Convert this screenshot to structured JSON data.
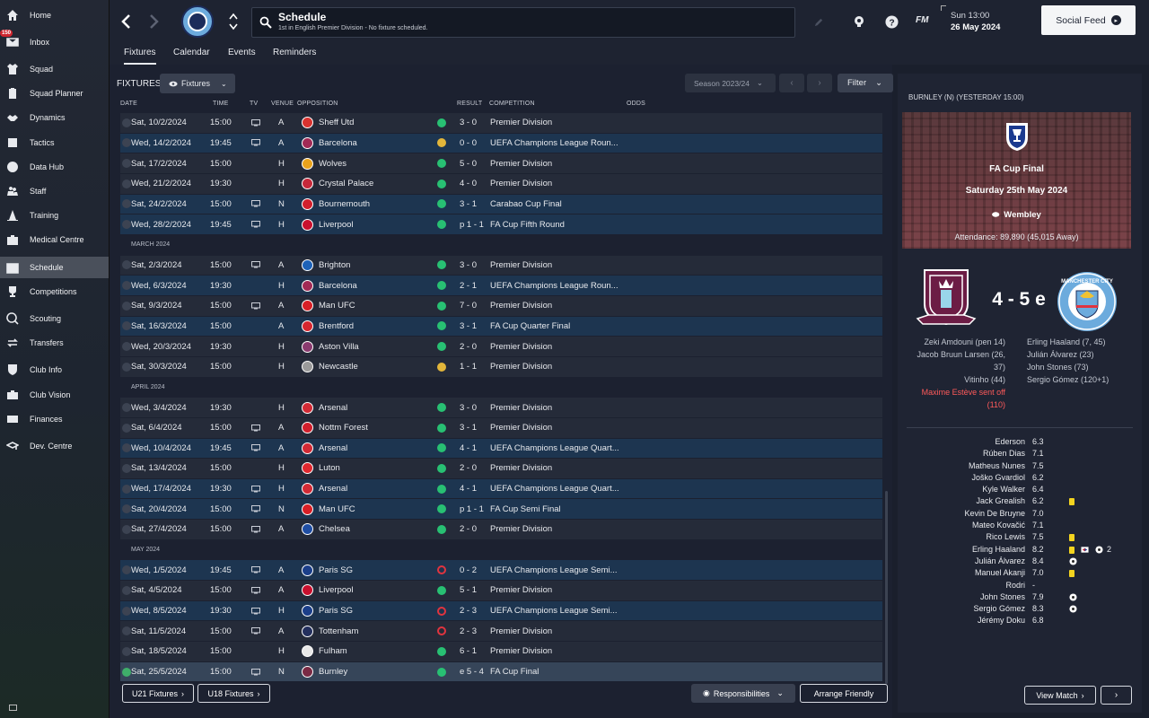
{
  "sidebar": {
    "items": [
      {
        "label": "Home",
        "icon": "home-icon"
      },
      {
        "label": "Inbox",
        "icon": "inbox-icon",
        "badge": "150"
      },
      {
        "label": "Squad",
        "icon": "shirt-icon"
      },
      {
        "label": "Squad Planner",
        "icon": "clipboard-icon"
      },
      {
        "label": "Dynamics",
        "icon": "handshake-icon"
      },
      {
        "label": "Tactics",
        "icon": "tactics-board-icon"
      },
      {
        "label": "Data Hub",
        "icon": "data-icon"
      },
      {
        "label": "Staff",
        "icon": "staff-icon"
      },
      {
        "label": "Training",
        "icon": "cone-icon"
      },
      {
        "label": "Medical Centre",
        "icon": "medical-icon"
      },
      {
        "label": "Schedule",
        "icon": "calendar-icon",
        "active": true
      },
      {
        "label": "Competitions",
        "icon": "trophy-icon"
      },
      {
        "label": "Scouting",
        "icon": "magnifier-icon"
      },
      {
        "label": "Transfers",
        "icon": "transfer-icon"
      },
      {
        "label": "Club Info",
        "icon": "shield-icon"
      },
      {
        "label": "Club Vision",
        "icon": "briefcase-icon"
      },
      {
        "label": "Finances",
        "icon": "money-icon"
      },
      {
        "label": "Dev. Centre",
        "icon": "graduation-icon"
      }
    ]
  },
  "header": {
    "title": "Schedule",
    "subtitle": "1st in English Premier Division - No fixture scheduled.",
    "brand": "FM",
    "day_time": "Sun 13:00",
    "date": "26 May 2024",
    "social_feed": "Social Feed"
  },
  "tabs": [
    "Fixtures",
    "Calendar",
    "Events",
    "Reminders"
  ],
  "toolbar": {
    "title": "FIXTURES",
    "view": "Fixtures",
    "season": "Season 2023/24",
    "filter": "Filter"
  },
  "columns": [
    "DATE",
    "TIME",
    "TV",
    "VENUE",
    "OPPOSITION",
    "RESULT",
    "COMPETITION",
    "ODDS"
  ],
  "fixtures": [
    {
      "type": "match",
      "date": "Sat, 10/2/2024",
      "time": "15:00",
      "tv": true,
      "venue": "A",
      "opp": "Sheff Utd",
      "outcome": "win",
      "result": "3 - 0",
      "comp": "Premier Division",
      "shade": "dark",
      "logo": "#d8322f"
    },
    {
      "type": "match",
      "date": "Wed, 14/2/2024",
      "time": "19:45",
      "tv": true,
      "venue": "A",
      "opp": "Barcelona",
      "outcome": "draw",
      "result": "0 - 0",
      "comp": "UEFA Champions League Roun...",
      "shade": "blue",
      "logo": "#a22a55"
    },
    {
      "type": "match",
      "date": "Sat, 17/2/2024",
      "time": "15:00",
      "tv": false,
      "venue": "H",
      "opp": "Wolves",
      "outcome": "win",
      "result": "5 - 0",
      "comp": "Premier Division",
      "shade": "dark",
      "logo": "#e9a21c"
    },
    {
      "type": "match",
      "date": "Wed, 21/2/2024",
      "time": "19:30",
      "tv": false,
      "venue": "H",
      "opp": "Crystal Palace",
      "outcome": "win",
      "result": "4 - 0",
      "comp": "Premier Division",
      "shade": "dark",
      "logo": "#c7293a"
    },
    {
      "type": "match",
      "date": "Sat, 24/2/2024",
      "time": "15:00",
      "tv": true,
      "venue": "N",
      "opp": "Bournemouth",
      "outcome": "win",
      "result": "3 - 1",
      "comp": "Carabao Cup Final",
      "shade": "blue",
      "logo": "#d11f2c"
    },
    {
      "type": "match",
      "date": "Wed, 28/2/2024",
      "time": "19:45",
      "tv": true,
      "venue": "H",
      "opp": "Liverpool",
      "outcome": "win",
      "result": "p 1 - 1",
      "comp": "FA Cup Fifth Round",
      "shade": "blue",
      "logo": "#c8102e"
    },
    {
      "type": "month",
      "label": "MARCH 2024"
    },
    {
      "type": "match",
      "date": "Sat, 2/3/2024",
      "time": "15:00",
      "tv": true,
      "venue": "A",
      "opp": "Brighton",
      "outcome": "win",
      "result": "3 - 0",
      "comp": "Premier Division",
      "shade": "dark",
      "logo": "#1d62b8"
    },
    {
      "type": "match",
      "date": "Wed, 6/3/2024",
      "time": "19:30",
      "tv": false,
      "venue": "H",
      "opp": "Barcelona",
      "outcome": "win",
      "result": "2 - 1",
      "comp": "UEFA Champions League Roun...",
      "shade": "blue",
      "logo": "#a22a55"
    },
    {
      "type": "match",
      "date": "Sat, 9/3/2024",
      "time": "15:00",
      "tv": true,
      "venue": "A",
      "opp": "Man UFC",
      "outcome": "win",
      "result": "7 - 0",
      "comp": "Premier Division",
      "shade": "dark",
      "logo": "#d81f26"
    },
    {
      "type": "match",
      "date": "Sat, 16/3/2024",
      "time": "15:00",
      "tv": false,
      "venue": "A",
      "opp": "Brentford",
      "outcome": "win",
      "result": "3 - 1",
      "comp": "FA Cup Quarter Final",
      "shade": "blue",
      "logo": "#d6262f"
    },
    {
      "type": "match",
      "date": "Wed, 20/3/2024",
      "time": "19:30",
      "tv": false,
      "venue": "H",
      "opp": "Aston Villa",
      "outcome": "win",
      "result": "2 - 0",
      "comp": "Premier Division",
      "shade": "dark",
      "logo": "#8a3a6f"
    },
    {
      "type": "match",
      "date": "Sat, 30/3/2024",
      "time": "15:00",
      "tv": false,
      "venue": "H",
      "opp": "Newcastle",
      "outcome": "draw",
      "result": "1 - 1",
      "comp": "Premier Division",
      "shade": "dark",
      "logo": "#9a9a9a"
    },
    {
      "type": "month",
      "label": "APRIL 2024"
    },
    {
      "type": "match",
      "date": "Wed, 3/4/2024",
      "time": "19:30",
      "tv": false,
      "venue": "H",
      "opp": "Arsenal",
      "outcome": "win",
      "result": "3 - 0",
      "comp": "Premier Division",
      "shade": "dark",
      "logo": "#d22a35"
    },
    {
      "type": "match",
      "date": "Sat, 6/4/2024",
      "time": "15:00",
      "tv": true,
      "venue": "A",
      "opp": "Nottm Forest",
      "outcome": "win",
      "result": "3 - 1",
      "comp": "Premier Division",
      "shade": "dark",
      "logo": "#d11f2c"
    },
    {
      "type": "match",
      "date": "Wed, 10/4/2024",
      "time": "19:45",
      "tv": true,
      "venue": "A",
      "opp": "Arsenal",
      "outcome": "win",
      "result": "4 - 1",
      "comp": "UEFA Champions League Quart...",
      "shade": "blue",
      "logo": "#d22a35"
    },
    {
      "type": "match",
      "date": "Sat, 13/4/2024",
      "time": "15:00",
      "tv": false,
      "venue": "H",
      "opp": "Luton",
      "outcome": "win",
      "result": "2 - 0",
      "comp": "Premier Division",
      "shade": "dark",
      "logo": "#e0282f"
    },
    {
      "type": "match",
      "date": "Wed, 17/4/2024",
      "time": "19:30",
      "tv": true,
      "venue": "H",
      "opp": "Arsenal",
      "outcome": "win",
      "result": "4 - 1",
      "comp": "UEFA Champions League Quart...",
      "shade": "blue",
      "logo": "#d22a35"
    },
    {
      "type": "match",
      "date": "Sat, 20/4/2024",
      "time": "15:00",
      "tv": true,
      "venue": "N",
      "opp": "Man UFC",
      "outcome": "win",
      "result": "p 1 - 1",
      "comp": "FA Cup Semi Final",
      "shade": "blue",
      "logo": "#d81f26"
    },
    {
      "type": "match",
      "date": "Sat, 27/4/2024",
      "time": "15:00",
      "tv": true,
      "venue": "A",
      "opp": "Chelsea",
      "outcome": "win",
      "result": "2 - 0",
      "comp": "Premier Division",
      "shade": "dark",
      "logo": "#1f4ea3"
    },
    {
      "type": "month",
      "label": "MAY 2024"
    },
    {
      "type": "match",
      "date": "Wed, 1/5/2024",
      "time": "19:45",
      "tv": true,
      "venue": "A",
      "opp": "Paris SG",
      "outcome": "loss",
      "result": "0 - 2",
      "comp": "UEFA Champions League Semi...",
      "shade": "blue",
      "logo": "#1b3f8a"
    },
    {
      "type": "match",
      "date": "Sat, 4/5/2024",
      "time": "15:00",
      "tv": true,
      "venue": "A",
      "opp": "Liverpool",
      "outcome": "win",
      "result": "5 - 1",
      "comp": "Premier Division",
      "shade": "dark",
      "logo": "#c8102e"
    },
    {
      "type": "match",
      "date": "Wed, 8/5/2024",
      "time": "19:30",
      "tv": true,
      "venue": "H",
      "opp": "Paris SG",
      "outcome": "loss",
      "result": "2 - 3",
      "comp": "UEFA Champions League Semi...",
      "shade": "blue",
      "logo": "#1b3f8a"
    },
    {
      "type": "match",
      "date": "Sat, 11/5/2024",
      "time": "15:00",
      "tv": true,
      "venue": "A",
      "opp": "Tottenham",
      "outcome": "loss",
      "result": "2 - 3",
      "comp": "Premier Division",
      "shade": "dark",
      "logo": "#24305e"
    },
    {
      "type": "match",
      "date": "Sat, 18/5/2024",
      "time": "15:00",
      "tv": false,
      "venue": "H",
      "opp": "Fulham",
      "outcome": "win",
      "result": "6 - 1",
      "comp": "Premier Division",
      "shade": "dark",
      "logo": "#e8e8e8"
    },
    {
      "type": "match",
      "date": "Sat, 25/5/2024",
      "time": "15:00",
      "tv": true,
      "venue": "N",
      "opp": "Burnley",
      "outcome": "win",
      "result": "e 5 - 4",
      "comp": "FA Cup Final",
      "shade": "sel",
      "logo": "#7a2a44"
    }
  ],
  "bottom": {
    "u21": "U21 Fixtures",
    "u18": "U18 Fixtures",
    "responsibilities": "Responsibilities",
    "arrange": "Arrange Friendly"
  },
  "match": {
    "header": "BURNLEY (N) (YESTERDAY 15:00)",
    "competition": "FA Cup Final",
    "date": "Saturday 25th May 2024",
    "venue": "Wembley",
    "attendance": "Attendance: 89,890 (45,015 Away)",
    "score": "4 - 5 e",
    "home_colors": {
      "primary": "#6c1d45",
      "secondary": "#99d6ea"
    },
    "away_colors": {
      "primary": "#6cabdd",
      "secondary": "#1c2c5b"
    },
    "away_crest_text": "MANCHESTER CITY",
    "home_scorers": [
      "Zeki Amdouni (pen 14)",
      "Jacob Bruun Larsen (26,",
      "37)",
      "Vitinho (44)"
    ],
    "home_red": [
      "Maxime Estève sent off",
      "(110)"
    ],
    "away_scorers": [
      "Erling Haaland (7, 45)",
      "Julián Álvarez (23)",
      "John Stones (73)",
      "Sergio Gómez (120+1)"
    ],
    "view_match": "View Match"
  },
  "ratings": [
    {
      "name": "Ederson",
      "rating": "6.3"
    },
    {
      "name": "Rúben Dias",
      "rating": "7.1"
    },
    {
      "name": "Matheus Nunes",
      "rating": "7.5"
    },
    {
      "name": "Joško Gvardiol",
      "rating": "6.2"
    },
    {
      "name": "Kyle Walker",
      "rating": "6.4"
    },
    {
      "name": "Jack Grealish",
      "rating": "6.2",
      "yellow": true
    },
    {
      "name": "Kevin De Bruyne",
      "rating": "7.0"
    },
    {
      "name": "Mateo Kovačić",
      "rating": "7.1"
    },
    {
      "name": "Rico Lewis",
      "rating": "7.5",
      "yellow": true
    },
    {
      "name": "Erling Haaland",
      "rating": "8.2",
      "yellow": true,
      "sub": true,
      "goals": "2"
    },
    {
      "name": "Julián Álvarez",
      "rating": "8.4",
      "goal": true
    },
    {
      "name": "Manuel Akanji",
      "rating": "7.0",
      "yellow": true
    },
    {
      "name": "Rodri",
      "rating": "-"
    },
    {
      "name": "John Stones",
      "rating": "7.9",
      "goal": true
    },
    {
      "name": "Sergio Gómez",
      "rating": "8.3",
      "goal": true
    },
    {
      "name": "Jérémy Doku",
      "rating": "6.8"
    }
  ]
}
